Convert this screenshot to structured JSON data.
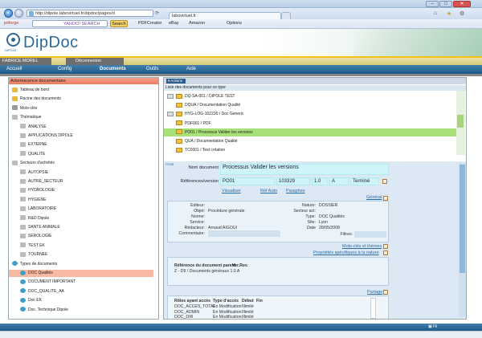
{
  "browser": {
    "url": "http://dipole.labovirtuel.fr/dipdoc/pages/d",
    "tab_label": "labovirtuel.fr",
    "search_placeholder": "Search",
    "search_btn": "Search",
    "toolbar": {
      "pdfcreator": "PDFCreator",
      "ebay": "eBay",
      "amazon": "Amazon",
      "options": "Options"
    },
    "jetforge": "jetforge",
    "yahoo": "YAHOO! SEARCH"
  },
  "app": {
    "logo": "DipDoc",
    "logo_sub": "DIPOLE",
    "user": "FABRICE MOREL",
    "logout": "Déconnexion",
    "menu": [
      "Accueil",
      "Config",
      "Documents",
      "Outils",
      "Aide"
    ]
  },
  "tree": {
    "title": "Arborescence documentaire",
    "items": [
      {
        "label": "Tableau de bord",
        "indent": 0,
        "icon": "dashboard-icon"
      },
      {
        "label": "Racine des documents",
        "indent": 0,
        "icon": "folder-icon"
      },
      {
        "label": "Mots-clés",
        "indent": 0,
        "icon": "keys-icon"
      },
      {
        "label": "Thématique",
        "indent": 0,
        "icon": "group-icon"
      },
      {
        "label": "ANALYSE",
        "indent": 1,
        "icon": "group-icon"
      },
      {
        "label": "APPLICATIONS DIPOLE",
        "indent": 1,
        "icon": "group-icon"
      },
      {
        "label": "EXTERNE",
        "indent": 1,
        "icon": "group-icon"
      },
      {
        "label": "QUALITE",
        "indent": 1,
        "icon": "group-icon"
      },
      {
        "label": "Secteurs d'activités",
        "indent": 0,
        "icon": "group-icon"
      },
      {
        "label": "AUTOPSIE",
        "indent": 1,
        "icon": "group-icon"
      },
      {
        "label": "AUTRE_SECTEUR",
        "indent": 1,
        "icon": "group-icon"
      },
      {
        "label": "HYDROLOGIE",
        "indent": 1,
        "icon": "group-icon"
      },
      {
        "label": "HYGIENE",
        "indent": 1,
        "icon": "group-icon"
      },
      {
        "label": "LABORATOIRE",
        "indent": 1,
        "icon": "group-icon"
      },
      {
        "label": "R&D Dipole",
        "indent": 1,
        "icon": "group-icon"
      },
      {
        "label": "SANTE ANIMALE",
        "indent": 1,
        "icon": "group-icon"
      },
      {
        "label": "SEROLOGIE",
        "indent": 1,
        "icon": "group-icon"
      },
      {
        "label": "TEST EK",
        "indent": 1,
        "icon": "group-icon"
      },
      {
        "label": "TOURNEE",
        "indent": 1,
        "icon": "group-icon"
      },
      {
        "label": "Types de documents",
        "indent": 0,
        "icon": "globe-icon"
      },
      {
        "label": "DOC Qualités",
        "indent": 1,
        "icon": "globe-icon",
        "selected": true
      },
      {
        "label": "DOCUMENT IMPORTANT",
        "indent": 1,
        "icon": "globe-icon"
      },
      {
        "label": "DOC_QUALITE_AA",
        "indent": 1,
        "icon": "globe-icon"
      },
      {
        "label": "Doc EK",
        "indent": 1,
        "icon": "globe-icon"
      },
      {
        "label": "Doc. Technique Dipole",
        "indent": 1,
        "icon": "globe-icon"
      }
    ]
  },
  "actions": {
    "label": "Actions"
  },
  "doclist": {
    "header": "Liste des documents pour ce type",
    "rows": [
      {
        "label": "DQ-SA-001 / DIPOLE TEST",
        "icons": 2
      },
      {
        "label": "DQUA / Documentation Qualité",
        "icons": 1
      },
      {
        "label": "HYG-LOG-102230 / Doc Generic",
        "icons": 2
      },
      {
        "label": "PDF001 / PDF",
        "icons": 1
      },
      {
        "label": "PO01 / Processus Valider les versions",
        "icons": 1,
        "selected": true
      },
      {
        "label": "QUA / Documentation Qualité",
        "icons": 1
      },
      {
        "label": "TC0001 / Test création",
        "icons": 1
      }
    ]
  },
  "detail": {
    "small_label": "PO08",
    "nom_label": "Nom document",
    "nom_value": "Processus Valider les versions",
    "ref_label": "Références/version",
    "ref_code": "PO01",
    "ref_num": "103329",
    "ref_ver": "1.0",
    "ref_letter": "A",
    "ref_status": "Terminé",
    "links": [
      "Visualiser",
      "Réf Auto",
      "Paraphes"
    ],
    "general_title": "Général",
    "general": {
      "editeur_l": "Editeur:",
      "editeur_v": "",
      "objet_l": "Objet:",
      "objet_v": "Procédure générale",
      "norme_l": "Norme:",
      "norme_v": "",
      "service_l": "Service:",
      "service_v": "",
      "redacteur_l": "Rédacteur:",
      "redacteur_v": "Arnaud AIGOUI",
      "commentaire_l": "Commentaire:",
      "commentaire_v": "",
      "nature_l": "Nature:",
      "nature_v": "DOSSIER",
      "secteur_l": "Secteur act:",
      "secteur_v": "",
      "type_l": "Type:",
      "type_v": "DOC Qualités",
      "site_l": "Site:",
      "site_v": "Lyon",
      "date_l": "Date",
      "date_v": "28/05/2008",
      "filtres_l": "Filtres:",
      "filtres_v": ""
    },
    "motscles": "Mots-clés et thèmes",
    "proprietes": "Propriétés spécifiques à la nature",
    "parent_head1": "Référence du document parent",
    "parent_head2": "Ver.Rev.",
    "parent_value": "Z - D9 / Documents généraux 1.0 A",
    "partage_title": "Partage",
    "partage_headers": [
      "Rôles ayant accès",
      "Type d'accès",
      "Début",
      "Fin"
    ],
    "partage_rows": [
      [
        "DOC_ACCES_TOTAL",
        "En Modification",
        "Illimité",
        ""
      ],
      [
        "DOC_ADMIN",
        "En Modification",
        "Illimité",
        ""
      ],
      [
        "DOC_DIR",
        "En Modification",
        "Illimité",
        ""
      ]
    ]
  },
  "status": {
    "label": "Fil"
  }
}
